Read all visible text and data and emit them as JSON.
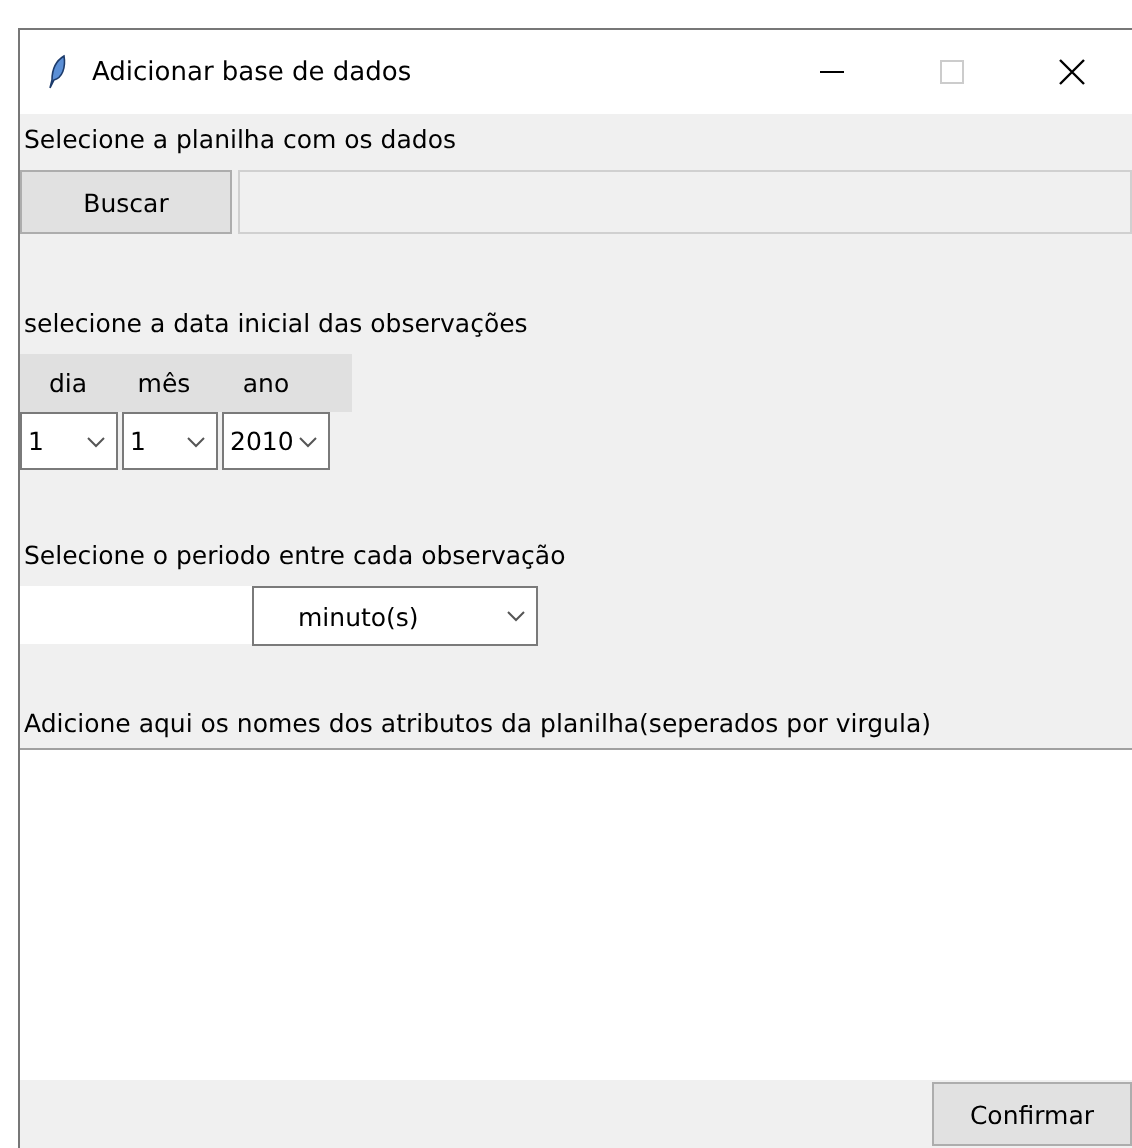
{
  "window": {
    "title": "Adicionar base de dados"
  },
  "file": {
    "label": "Selecione a planilha com os dados",
    "button": "Buscar"
  },
  "date": {
    "label": "selecione a data inicial das observações",
    "fields": [
      {
        "label": "dia",
        "value": "1"
      },
      {
        "label": "mês",
        "value": "1"
      },
      {
        "label": "ano",
        "value": "2010"
      }
    ]
  },
  "period": {
    "label": "Selecione o periodo entre cada observação",
    "unit": "minuto(s)"
  },
  "attributes": {
    "label": "Adicione aqui os nomes dos atributos da planilha(seperados por virgula)"
  },
  "buttons": [
    "Confirmar"
  ]
}
